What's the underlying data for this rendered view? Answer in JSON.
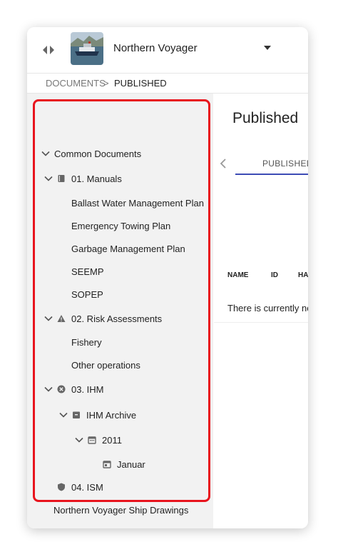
{
  "header": {
    "vessel_name": "Northern Voyager",
    "toggle_icon": "left-right-arrows-icon",
    "dropdown_icon": "caret-down-icon"
  },
  "breadcrumb": {
    "items": [
      "DOCUMENTS",
      "PUBLISHED"
    ],
    "separator": ">"
  },
  "tree": {
    "root": "Common Documents",
    "manuals": {
      "label": "01. Manuals",
      "icon": "book-icon",
      "children": [
        "Ballast Water Management Plan",
        "Emergency Towing Plan",
        "Garbage Management Plan",
        "SEEMP",
        "SOPEP"
      ]
    },
    "risk": {
      "label": "02. Risk Assessments",
      "icon": "warning-icon",
      "children": [
        "Fishery",
        "Other operations"
      ]
    },
    "ihm": {
      "label": "03. IHM",
      "icon": "x-circle-icon",
      "archive": "IHM Archive",
      "year": "2011",
      "month": "Januar"
    },
    "ism": {
      "label": "04. ISM",
      "icon": "shield-icon"
    },
    "drawings": "Northern Voyager Ship Drawings"
  },
  "main": {
    "title": "Published",
    "tab": "PUBLISHED",
    "columns": [
      "NAME",
      "ID",
      "HA"
    ],
    "empty_message": "There is currently no"
  },
  "colors": {
    "highlight": "#e8141d",
    "tab_indicator": "#3d4cb5",
    "sidebar_bg": "#f2f2f2"
  }
}
